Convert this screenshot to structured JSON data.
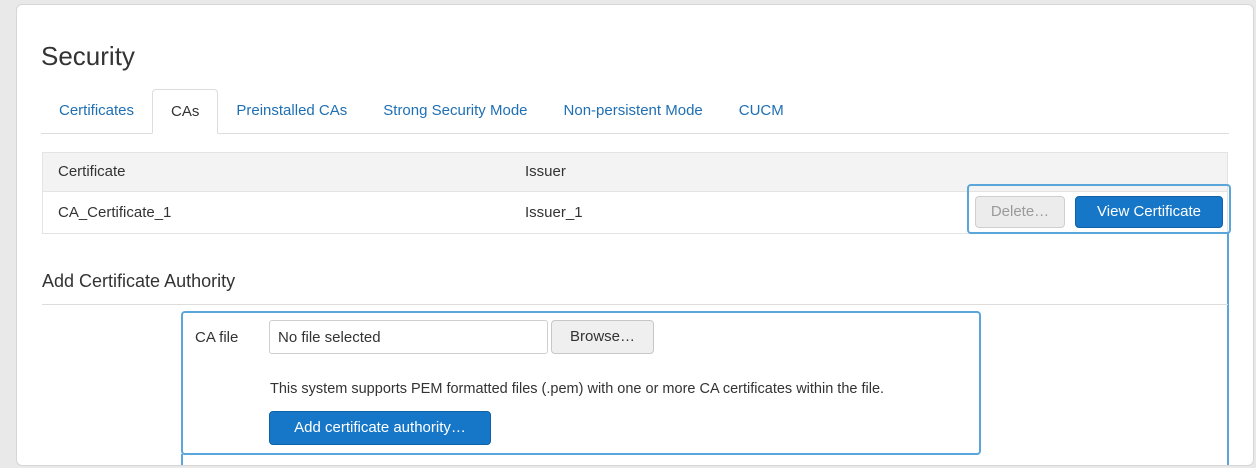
{
  "page": {
    "title": "Security"
  },
  "tabs": [
    {
      "label": "Certificates",
      "active": false
    },
    {
      "label": "CAs",
      "active": true
    },
    {
      "label": "Preinstalled CAs",
      "active": false
    },
    {
      "label": "Strong Security Mode",
      "active": false
    },
    {
      "label": "Non-persistent Mode",
      "active": false
    },
    {
      "label": "CUCM",
      "active": false
    }
  ],
  "table": {
    "headers": [
      "Certificate",
      "Issuer"
    ],
    "rows": [
      {
        "certificate": "CA_Certificate_1",
        "issuer": "Issuer_1"
      }
    ],
    "delete_label": "Delete…",
    "view_label": "View Certificate"
  },
  "add_ca": {
    "title": "Add Certificate Authority",
    "file_label": "CA file",
    "file_value": "No file selected",
    "browse_label": "Browse…",
    "help_text": "This system supports PEM formatted files (.pem) with one or more CA certificates within the file.",
    "submit_label": "Add certificate authority…"
  },
  "colors": {
    "accent": "#1677c8",
    "link": "#1e6fb4",
    "highlight": "#5aa6db"
  }
}
